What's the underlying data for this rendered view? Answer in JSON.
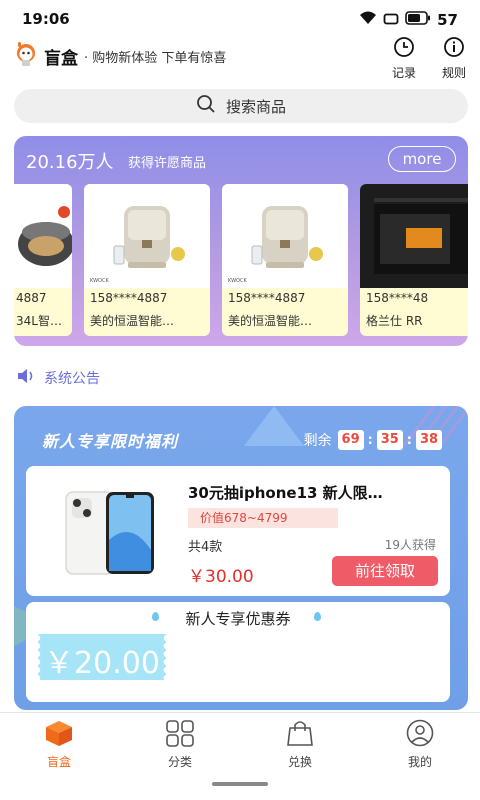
{
  "status_bar": {
    "time": "19:06",
    "battery": "57"
  },
  "header": {
    "app_name": "盲盒",
    "slogan": "· 购物新体验 下单有惊喜",
    "records_label": "记录",
    "rules_label": "规则"
  },
  "search": {
    "placeholder": "搜索商品"
  },
  "wish_banner": {
    "count": "20.16万人",
    "description": "获得许愿商品",
    "more_label": "more",
    "cards": [
      {
        "phone": "4887",
        "name": "34L智…"
      },
      {
        "phone": "158****4887",
        "name": "美的恒温智能…"
      },
      {
        "phone": "158****4887",
        "name": "美的恒温智能…"
      },
      {
        "phone": "158****48",
        "name": "格兰仕 RR"
      }
    ]
  },
  "announcement": {
    "label": "系统公告"
  },
  "newcomer": {
    "title": "新人专享限时福利",
    "countdown_label": "剩余",
    "countdown": {
      "hours": "69",
      "minutes": "35",
      "seconds": "38"
    },
    "product": {
      "title": "30元抽iphone13 新人限…",
      "value_tag": "价值678~4799",
      "total": "共4款",
      "obtained": "19人获得",
      "price": "￥30.00",
      "button_label": "前往领取"
    },
    "coupon": {
      "title": "新人专享优惠券",
      "amount": "￥20.00"
    }
  },
  "bottom_nav": [
    {
      "label": "盲盒",
      "active": true
    },
    {
      "label": "分类",
      "active": false
    },
    {
      "label": "兑换",
      "active": false
    },
    {
      "label": "我的",
      "active": false
    }
  ],
  "colors": {
    "accent_orange": "#f06a1a",
    "banner_purple": "#8f8ee8",
    "newcomer_blue": "#7aa7ec",
    "price_red": "#e0312c",
    "button_red": "#ef5b66"
  }
}
